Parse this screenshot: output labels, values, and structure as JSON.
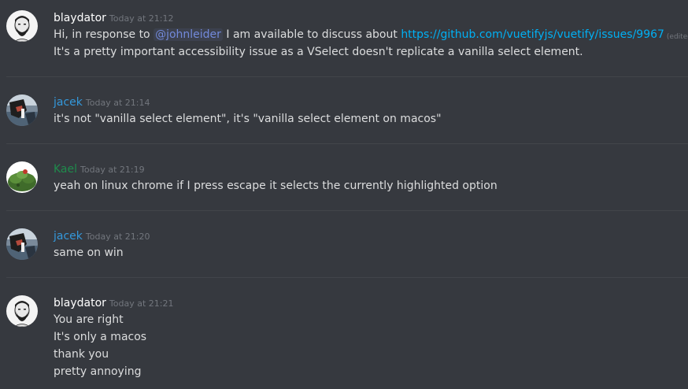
{
  "colors": {
    "background": "#36393f",
    "divider": "#42454a",
    "text": "#dcddde",
    "timestamp": "#72767d",
    "link": "#00b0f4",
    "mention": "#7289da"
  },
  "messages": [
    {
      "username": "blaydator",
      "username_color": "#ffffff",
      "avatar_icon": "bearded-man-avatar",
      "timestamp": "Today at 21:12",
      "lines": [
        {
          "prefix": "Hi, in response to ",
          "mention": "@johnleider",
          "middle": " I am available to discuss about ",
          "link": "https://github.com/vuetifyjs/vuetify/issues/9967",
          "edited": "(edited)"
        },
        "It's a pretty important accessibility issue as a VSelect doesn't replicate a vanilla select element."
      ]
    },
    {
      "username": "jacek",
      "username_color": "#3498db",
      "avatar_icon": "dark-photo-avatar",
      "timestamp": "Today at 21:14",
      "lines": [
        "it's not \"vanilla select element\", it's \"vanilla select element on macos\""
      ]
    },
    {
      "username": "Kael",
      "username_color": "#1f8b4c",
      "avatar_icon": "leafy-plant-avatar",
      "timestamp": "Today at 21:19",
      "lines": [
        "yeah on linux chrome if I press escape it selects the currently highlighted option"
      ]
    },
    {
      "username": "jacek",
      "username_color": "#3498db",
      "avatar_icon": "dark-photo-avatar",
      "timestamp": "Today at 21:20",
      "lines": [
        "same on win"
      ]
    },
    {
      "username": "blaydator",
      "username_color": "#ffffff",
      "avatar_icon": "bearded-man-avatar",
      "timestamp": "Today at 21:21",
      "lines": [
        "You are right",
        "It's only a macos",
        "thank you",
        "pretty annoying"
      ]
    }
  ]
}
